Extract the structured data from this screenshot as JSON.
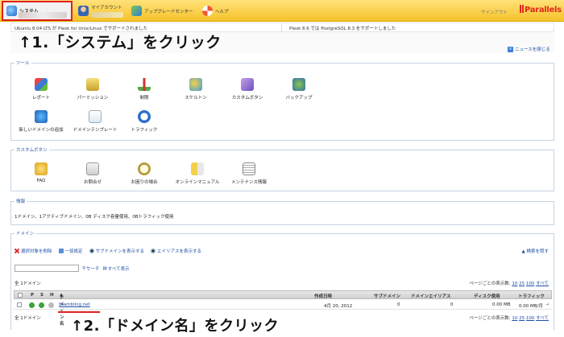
{
  "topbar": {
    "system_label": "システム",
    "my_account_label": "マイアカウント",
    "upgrade_center_label": "アップグレードセンター",
    "help_label": "ヘルプ",
    "signout_label": "サインアウト",
    "brand_label": "Parallels"
  },
  "news": {
    "item1": "Ubuntu 8.04 LTS が Plesk for Unix/Linux でサポートされました",
    "item2": "Plesk 8.6 では PostgreSQL 8.3 をサポートしました",
    "close_label": "ニュースを閉じる"
  },
  "tools": {
    "title": "ツール",
    "items": [
      {
        "label": "レポート",
        "icon": "report-icon"
      },
      {
        "label": "パーミッション",
        "icon": "permission-icon"
      },
      {
        "label": "制限",
        "icon": "limits-icon"
      },
      {
        "label": "スケルトン",
        "icon": "skeleton-icon"
      },
      {
        "label": "カスタムボタン",
        "icon": "custom-button-icon"
      },
      {
        "label": "バックアップ",
        "icon": "backup-icon"
      },
      {
        "label": "新しいドメインの追加",
        "icon": "add-domain-icon"
      },
      {
        "label": "ドメインテンプレート",
        "icon": "domain-template-icon"
      },
      {
        "label": "トラフィック",
        "icon": "traffic-icon"
      }
    ]
  },
  "custom_buttons": {
    "title": "カスタムボタン",
    "items": [
      {
        "label": "FAQ",
        "icon": "faq-icon"
      },
      {
        "label": "お問合せ",
        "icon": "mail-icon"
      },
      {
        "label": "お困りの場合",
        "icon": "help-search-icon"
      },
      {
        "label": "オンラインマニュアル",
        "icon": "manual-icon"
      },
      {
        "label": "メンテナンス情報",
        "icon": "news-icon"
      }
    ]
  },
  "info": {
    "title": "情報",
    "text": "1ドメイン、1アクティブドメイン、0B ディスク容量使用、0Bトラフィック使用"
  },
  "domains": {
    "title": "ドメイン",
    "actions": [
      "選択対象を削除",
      "一括設定",
      "サブドメインを表示する",
      "エイリアスを表示する"
    ],
    "search_options_label": "検索を隠す",
    "search_button": "サーチ",
    "show_all": "すべて表示",
    "count_label": "全 1ドメイン",
    "per_page_label": "ページごとの表示数:",
    "per_page_options": [
      "10",
      "25",
      "100",
      "すべて"
    ],
    "columns": {
      "p": "P",
      "s": "S",
      "h": "H",
      "domain_name": "ドメイン名",
      "created": "作成日時",
      "subdomains": "サブドメイン",
      "aliases": "ドメインエイリアス",
      "disk": "ディスク使用",
      "traffic": "トラフィック"
    },
    "rows": [
      {
        "domain": "brambling.net",
        "created": "4月 20, 2012",
        "subdomains": "0",
        "aliases": "0",
        "disk": "0.00 MB",
        "traffic": "0.00 MB/月"
      }
    ]
  },
  "annotations": {
    "step1": "↑1.「システム」をクリック",
    "step2": "↑2.「ドメイン名」をクリック"
  }
}
